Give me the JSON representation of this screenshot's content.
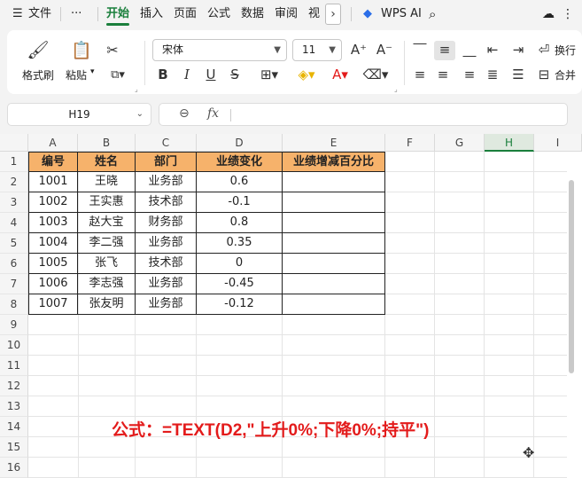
{
  "menubar": {
    "file": "文件",
    "more": "···",
    "tabs": [
      "开始",
      "插入",
      "页面",
      "公式",
      "数据",
      "审阅",
      "视"
    ],
    "active_tab": "开始",
    "wps_ai": "WPS AI"
  },
  "ribbon": {
    "format_painter": "格式刷",
    "paste": "粘贴",
    "font_name": "宋体",
    "font_size": "11",
    "wrap": "换行",
    "merge": "合并"
  },
  "formula_bar": {
    "cell_ref": "H19",
    "fx": "fx",
    "formula": ""
  },
  "sheet": {
    "columns": [
      "A",
      "B",
      "C",
      "D",
      "E",
      "F",
      "G",
      "H",
      "I"
    ],
    "selected_column": "H",
    "rows": [
      "1",
      "2",
      "3",
      "4",
      "5",
      "6",
      "7",
      "8",
      "9",
      "10",
      "11",
      "12",
      "13",
      "14",
      "15",
      "16"
    ],
    "table_header": [
      "编号",
      "姓名",
      "部门",
      "业绩变化",
      "业绩增减百分比"
    ],
    "table_rows": [
      [
        "1001",
        "王晓",
        "业务部",
        "0.6",
        ""
      ],
      [
        "1002",
        "王实惠",
        "技术部",
        "-0.1",
        ""
      ],
      [
        "1003",
        "赵大宝",
        "财务部",
        "0.8",
        ""
      ],
      [
        "1004",
        "李二强",
        "业务部",
        "0.35",
        ""
      ],
      [
        "1005",
        "张飞",
        "技术部",
        "0",
        ""
      ],
      [
        "1006",
        "李志强",
        "业务部",
        "-0.45",
        ""
      ],
      [
        "1007",
        "张友明",
        "业务部",
        "-0.12",
        ""
      ]
    ]
  },
  "annotation": "公式：=TEXT(D2,\"上升0%;下降0%;持平\")",
  "colors": {
    "accent": "#1a7f3c",
    "header_fill": "#f6b26b",
    "annotation": "#e31b1b"
  }
}
